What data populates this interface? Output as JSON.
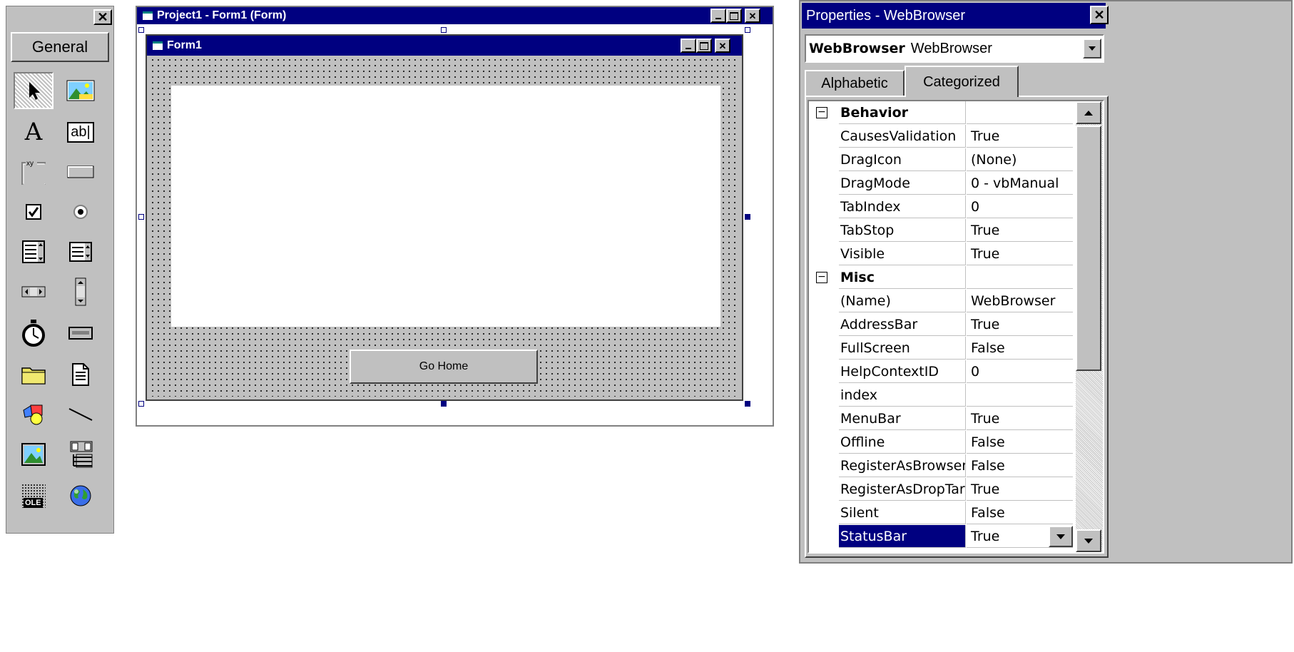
{
  "toolbox": {
    "close_label": "✕",
    "general_label": "General",
    "tools": [
      {
        "name": "pointer-icon"
      },
      {
        "name": "picturebox-icon"
      },
      {
        "name": "label-icon",
        "glyph": "A"
      },
      {
        "name": "textbox-icon",
        "glyph": "ab|"
      },
      {
        "name": "frame-icon",
        "glyph": "xy"
      },
      {
        "name": "commandbutton-icon"
      },
      {
        "name": "checkbox-icon"
      },
      {
        "name": "optionbutton-icon"
      },
      {
        "name": "combobox-icon"
      },
      {
        "name": "listbox-icon"
      },
      {
        "name": "hscrollbar-icon"
      },
      {
        "name": "vscrollbar-icon"
      },
      {
        "name": "timer-icon"
      },
      {
        "name": "drivelistbox-icon"
      },
      {
        "name": "dirlistbox-icon"
      },
      {
        "name": "filelistbox-icon"
      },
      {
        "name": "shape-icon"
      },
      {
        "name": "line-icon"
      },
      {
        "name": "image-icon"
      },
      {
        "name": "data-icon"
      },
      {
        "name": "ole-icon",
        "glyph": "OLE"
      },
      {
        "name": "webbrowser-icon"
      }
    ]
  },
  "designer": {
    "title": "Project1 - Form1 (Form)",
    "form_title": "Form1",
    "go_home_label": "Go Home"
  },
  "properties": {
    "title": "Properties - WebBrowser",
    "object_name": "WebBrowser",
    "object_type": "WebBrowser",
    "tabs": [
      "Alphabetic",
      "Categorized"
    ],
    "rows": [
      {
        "type": "category",
        "name": "Behavior",
        "value": ""
      },
      {
        "type": "prop",
        "name": "CausesValidation",
        "value": "True"
      },
      {
        "type": "prop",
        "name": "DragIcon",
        "value": "(None)"
      },
      {
        "type": "prop",
        "name": "DragMode",
        "value": "0 - vbManual"
      },
      {
        "type": "prop",
        "name": "TabIndex",
        "value": "0"
      },
      {
        "type": "prop",
        "name": "TabStop",
        "value": "True"
      },
      {
        "type": "prop",
        "name": "Visible",
        "value": "True"
      },
      {
        "type": "category",
        "name": "Misc",
        "value": ""
      },
      {
        "type": "prop",
        "name": "(Name)",
        "value": "WebBrowser"
      },
      {
        "type": "prop",
        "name": "AddressBar",
        "value": "True"
      },
      {
        "type": "prop",
        "name": "FullScreen",
        "value": "False"
      },
      {
        "type": "prop",
        "name": "HelpContextID",
        "value": "0"
      },
      {
        "type": "prop",
        "name": "index",
        "value": ""
      },
      {
        "type": "prop",
        "name": "MenuBar",
        "value": "True"
      },
      {
        "type": "prop",
        "name": "Offline",
        "value": "False"
      },
      {
        "type": "prop",
        "name": "RegisterAsBrowser",
        "value": "False"
      },
      {
        "type": "prop",
        "name": "RegisterAsDropTarget",
        "value": "True"
      },
      {
        "type": "prop",
        "name": "Silent",
        "value": "False"
      },
      {
        "type": "prop",
        "name": "StatusBar",
        "value": "True",
        "selected": true
      }
    ]
  },
  "colors": {
    "titlebar": "#000080",
    "face": "#c0c0c0",
    "selection": "#000080"
  }
}
